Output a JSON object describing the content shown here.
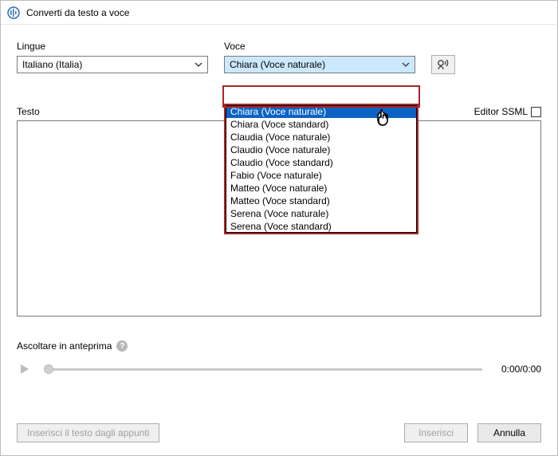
{
  "window": {
    "title": "Converti da testo a voce"
  },
  "labels": {
    "lingue": "Lingue",
    "voce": "Voce",
    "testo": "Testo",
    "editor_ssml": "Editor SSML",
    "preview": "Ascoltare in anteprima"
  },
  "lang_select": {
    "value": "Italiano (Italia)"
  },
  "voice_select": {
    "value": "Chiara (Voce naturale)",
    "options": [
      "Chiara (Voce naturale)",
      "Chiara (Voce standard)",
      "Claudia (Voce naturale)",
      "Claudio (Voce naturale)",
      "Claudio (Voce standard)",
      "Fabio (Voce naturale)",
      "Matteo (Voce naturale)",
      "Matteo (Voce standard)",
      "Serena (Voce naturale)",
      "Serena (Voce standard)"
    ],
    "selected_index": 0
  },
  "player": {
    "time": "0:00/0:00"
  },
  "buttons": {
    "clipboard": "Inserisci il testo dagli appunti",
    "insert": "Inserisci",
    "cancel": "Annulla"
  },
  "icons": {
    "app": "app-icon",
    "chevron_down": "chevron-down-icon",
    "speak": "speak-icon",
    "help": "?",
    "play": "play-icon",
    "cursor": "pointer-cursor"
  },
  "colors": {
    "highlight_red": "#aa2626",
    "select_blue": "#0a63c4",
    "select_bg": "#cce8ff"
  }
}
